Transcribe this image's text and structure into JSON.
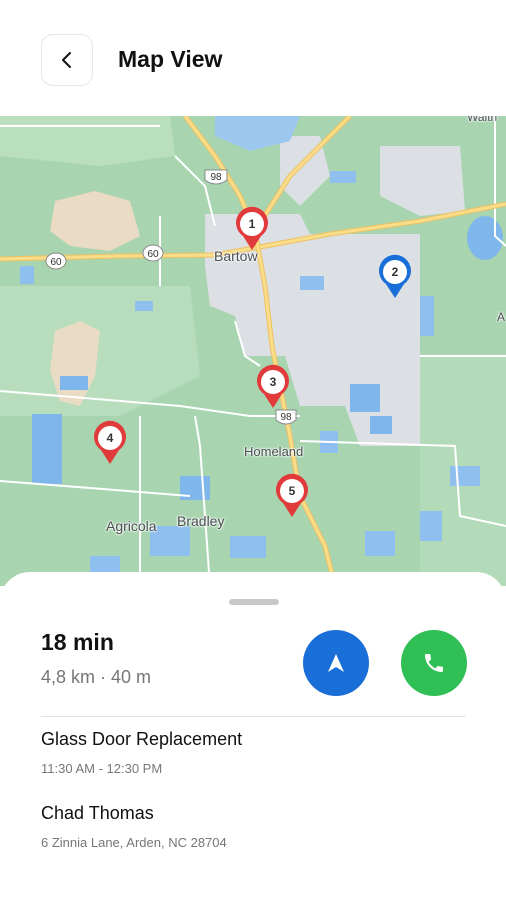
{
  "header": {
    "title": "Map View"
  },
  "icons": {
    "back": "chevron-left-icon",
    "navigate": "navigation-arrow-icon",
    "call": "phone-icon"
  },
  "colors": {
    "pin_red": "#e03a3a",
    "pin_blue": "#1a6ed8",
    "navigate_button": "#1a6ed8",
    "call_button": "#2fbf55"
  },
  "map": {
    "labels": {
      "bartow": "Bartow",
      "homeland": "Homeland",
      "agricola": "Agricola",
      "bradley": "Bradley",
      "edge_top": "Walth",
      "edge_right": "A"
    },
    "shields": {
      "hwy98_north": "98",
      "hwy60_west": "60",
      "hwy60_east": "60",
      "hwy98_south": "98"
    },
    "markers": [
      {
        "label": "1",
        "color": "red"
      },
      {
        "label": "2",
        "color": "blue"
      },
      {
        "label": "3",
        "color": "red"
      },
      {
        "label": "4",
        "color": "red"
      },
      {
        "label": "5",
        "color": "red"
      }
    ]
  },
  "route": {
    "eta": "18 min",
    "distance": "4,8 km · 40 m"
  },
  "job": {
    "title": "Glass Door Replacement",
    "time": "11:30 AM - 12:30 PM"
  },
  "customer": {
    "name": "Chad Thomas",
    "address": "6 Zinnia Lane, Arden, NC 28704"
  }
}
